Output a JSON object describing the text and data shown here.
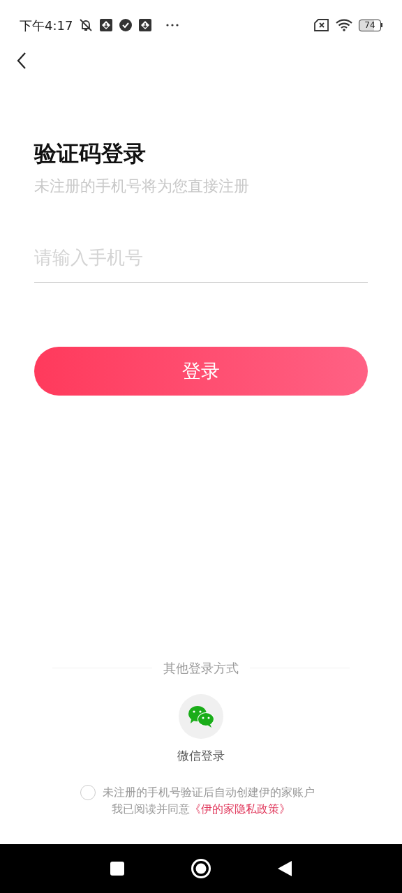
{
  "status_bar": {
    "time": "下午4:17",
    "battery": "74"
  },
  "title": "验证码登录",
  "subtitle": "未注册的手机号将为您直接注册",
  "phone_field": {
    "placeholder": "请输入手机号"
  },
  "login_button": "登录",
  "other_login": {
    "label": "其他登录方式",
    "methods": [
      {
        "kind": "wechat",
        "label": "微信登录"
      }
    ]
  },
  "agreement": {
    "checked": false,
    "line1": "未注册的手机号验证后自动创建伊的家账户",
    "line2": "我已阅读并同意",
    "policy_link": "《伊的家隐私政策》"
  }
}
